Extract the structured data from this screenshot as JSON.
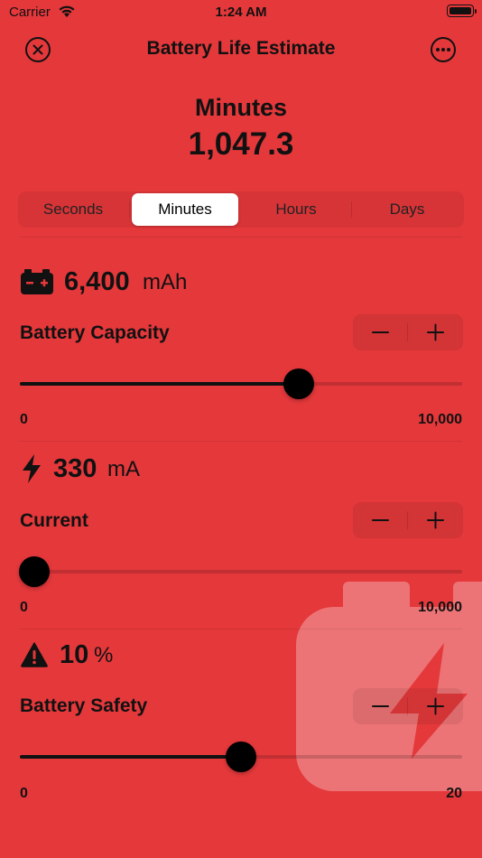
{
  "status_bar": {
    "carrier": "Carrier",
    "time": "1:24 AM"
  },
  "nav": {
    "title": "Battery Life Estimate",
    "close_icon": "close-circle-icon",
    "more_icon": "more-circle-icon"
  },
  "result": {
    "unit": "Minutes",
    "value": "1,047.3"
  },
  "time_units": {
    "options": [
      "Seconds",
      "Minutes",
      "Hours",
      "Days"
    ],
    "selected": "Minutes"
  },
  "capacity": {
    "icon": "car-battery-icon",
    "value": "6,400",
    "unit": "mAh",
    "label": "Battery Capacity",
    "slider_fraction": 0.63,
    "min": "0",
    "max": "10,000"
  },
  "current": {
    "icon": "bolt-icon",
    "value": "330",
    "unit": "mA",
    "label": "Current",
    "slider_fraction": 0.033,
    "min": "0",
    "max": "10,000"
  },
  "safety": {
    "icon": "warning-triangle-icon",
    "value": "10",
    "unit": "%",
    "label": "Battery Safety",
    "slider_fraction": 0.5,
    "min": "0",
    "max": "20"
  },
  "stepper": {
    "minus": "−",
    "plus": "+"
  },
  "colors": {
    "background": "#e4383b",
    "text": "#111111",
    "thumb": "#000000"
  }
}
